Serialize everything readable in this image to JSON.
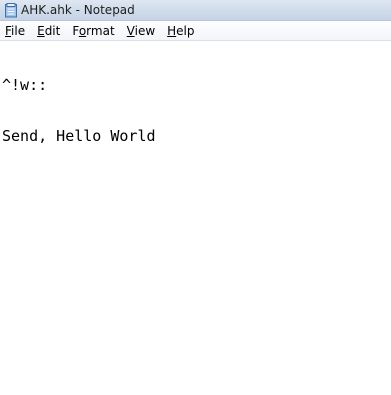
{
  "window": {
    "title": "AHK.ahk - Notepad",
    "icon": "notepad-icon"
  },
  "menu": {
    "items": [
      {
        "mnemonic": "F",
        "rest": "ile"
      },
      {
        "mnemonic": "E",
        "rest": "dit"
      },
      {
        "pre": "F",
        "mnemonic": "o",
        "rest": "rmat"
      },
      {
        "mnemonic": "V",
        "rest": "iew"
      },
      {
        "mnemonic": "H",
        "rest": "elp"
      }
    ]
  },
  "editor": {
    "lines": [
      "^!w::",
      "Send, Hello World"
    ]
  },
  "colors": {
    "titlebar": "#cfdbea",
    "background": "#ffffff",
    "text": "#000000"
  }
}
